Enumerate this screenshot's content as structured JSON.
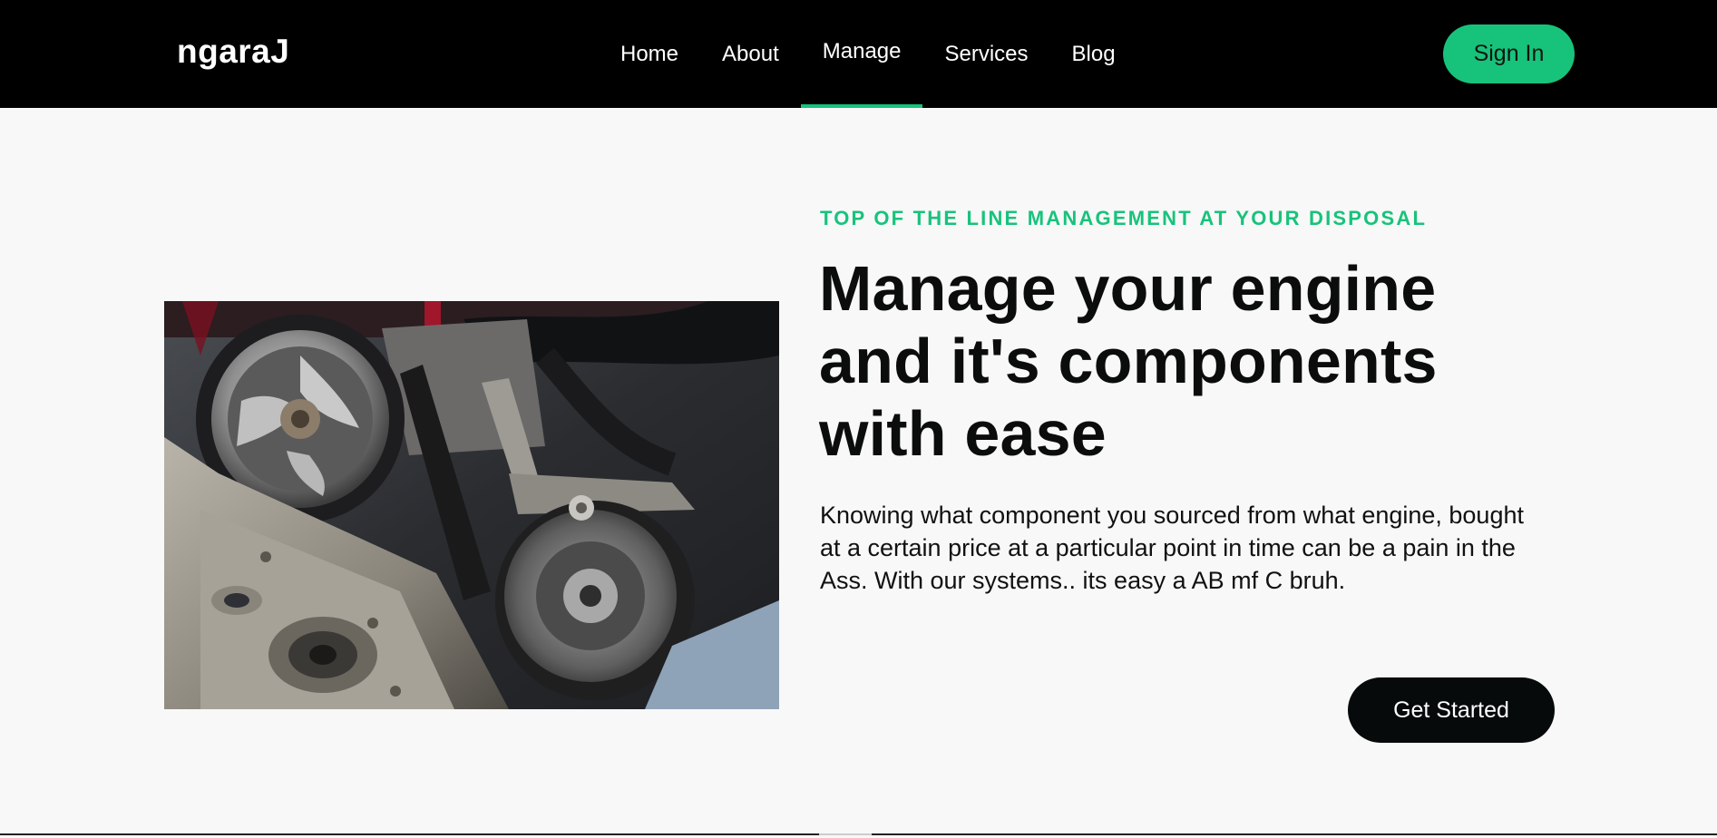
{
  "brand": {
    "name": "ngaraJ",
    "accent_color": "#17c37b"
  },
  "nav": {
    "items": [
      {
        "label": "Home"
      },
      {
        "label": "About"
      },
      {
        "label": "Manage"
      },
      {
        "label": "Services"
      },
      {
        "label": "Blog"
      }
    ],
    "active": "Manage",
    "signin_label": "Sign In"
  },
  "hero": {
    "eyebrow": "TOP OF THE LINE MANAGEMENT AT YOUR DISPOSAL",
    "headline": "Manage your engine and it's components with ease",
    "description": "Knowing what component you sourced from what engine, bought at a certain price at a particular point in time can be a pain in the Ass. With our systems.. its easy a AB mf C bruh.",
    "cta_label": "Get Started",
    "image_subject": "car-engine-photo"
  }
}
